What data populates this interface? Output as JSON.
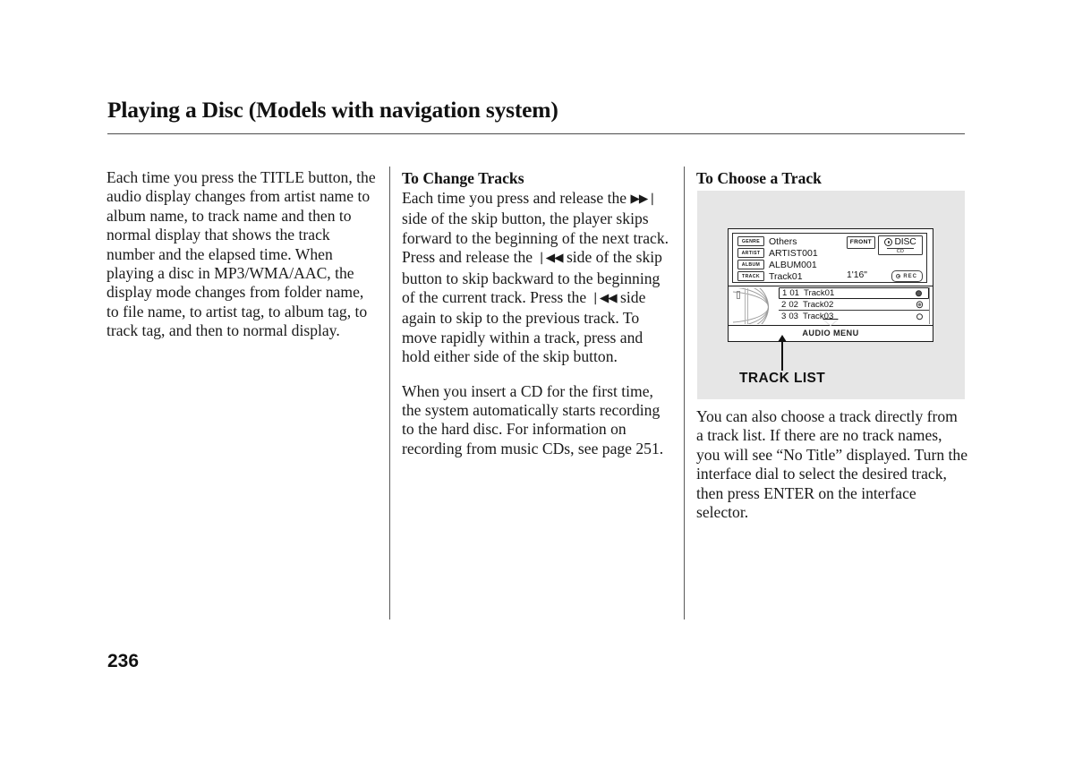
{
  "header": {
    "title": "Playing a Disc (Models with navigation system)"
  },
  "columns": {
    "col1": {
      "paragraph": "Each time you press the TITLE button, the audio display changes from artist name to album name, to track name and then to normal display that shows the track number and the elapsed time. When playing a disc in MP3/WMA/AAC, the display mode changes from folder name, to file name, to artist tag, to album tag, to track tag, and then to normal display."
    },
    "col2": {
      "heading": "To Change Tracks",
      "paragraph1_part1": "Each time you press and release the ",
      "skip_forward_glyph": "▶▶❘",
      "paragraph1_part2": " side of the skip button, the player skips forward to the beginning of the next track. Press and release the ",
      "skip_back_glyph": "❘◀◀",
      "paragraph1_part3": " side of the skip button to skip backward to the beginning of the current track. Press the ",
      "paragraph1_part4": " side again to skip to the previous track. To move rapidly within a track, press and hold either side of the skip button.",
      "paragraph2": "When you insert a CD for the first time, the system automatically starts recording to the hard disc. For information on recording from music CDs, see page 251."
    },
    "col3": {
      "heading": "To Choose a Track",
      "paragraph": "You can also choose a track directly from a track list. If there are no track names, you will see “No Title” displayed. Turn the interface dial to select the desired track, then press ENTER on the interface selector."
    }
  },
  "illustration": {
    "callout_label": "TRACK LIST",
    "screen": {
      "info_rows": [
        {
          "tag": "GENRE",
          "value": "Others"
        },
        {
          "tag": "ARTIST",
          "value": "ARTIST001"
        },
        {
          "tag": "ALBUM",
          "value": "ALBUM001"
        },
        {
          "tag": "TRACK",
          "value": "Track01"
        }
      ],
      "front_label": "FRONT",
      "disc_label": "DISC",
      "disc_sublabel": "CD",
      "elapsed_time": "1'16\"",
      "rec_label": "REC",
      "tracks": [
        {
          "index": "1",
          "number": "01",
          "title": "Track01",
          "mark": "filled",
          "selected": true
        },
        {
          "index": "2",
          "number": "02",
          "title": "Track02",
          "mark": "half",
          "selected": false
        },
        {
          "index": "3",
          "number": "03",
          "title": "Track03",
          "mark": "empty",
          "selected": false
        }
      ],
      "menu_label": "AUDIO MENU"
    }
  },
  "footer": {
    "page_number": "236"
  }
}
